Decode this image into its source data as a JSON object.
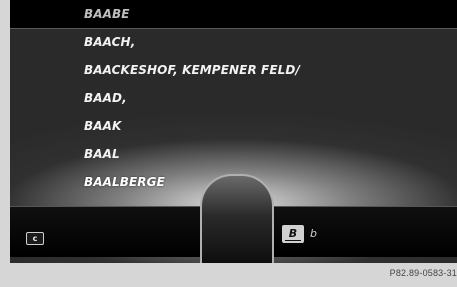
{
  "list": {
    "items": [
      {
        "label": "BAABE"
      },
      {
        "label": "BAACH,"
      },
      {
        "label": "BAACKESHOF, KEMPENER FELD/"
      },
      {
        "label": "BAAD,"
      },
      {
        "label": "BAAK"
      },
      {
        "label": "BAAL"
      },
      {
        "label": "BAALBERGE"
      }
    ],
    "selected_index": 0
  },
  "bottom_bar": {
    "c_button_label": "c",
    "selected_char": "B",
    "next_char": "b"
  },
  "caption": "P82.89-0583-31",
  "colors": {
    "background": "#2a2a2a",
    "selected_row": "#000000",
    "text": "#f2f2f2",
    "caption_bg": "#d6d6d6"
  }
}
